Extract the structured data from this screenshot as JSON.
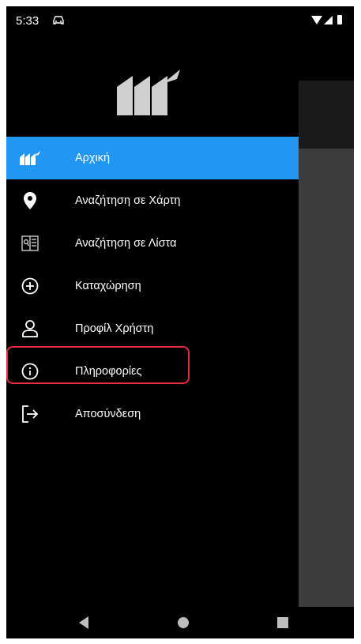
{
  "status_bar": {
    "time": "5:33"
  },
  "drawer": {
    "items": [
      {
        "label": "Αρχική",
        "icon": "home-logo-icon",
        "active": true
      },
      {
        "label": "Αναζήτηση σε Χάρτη",
        "icon": "map-pin-icon",
        "active": false
      },
      {
        "label": "Αναζήτηση σε Λίστα",
        "icon": "list-search-icon",
        "active": false
      },
      {
        "label": "Καταχώρηση",
        "icon": "add-circle-icon",
        "active": false
      },
      {
        "label": "Προφίλ Χρήστη",
        "icon": "user-icon",
        "active": false
      },
      {
        "label": "Πληροφορίες",
        "icon": "info-icon",
        "active": false
      },
      {
        "label": "Αποσύνδεση",
        "icon": "logout-icon",
        "active": false
      }
    ]
  },
  "colors": {
    "accent": "#2196f3",
    "highlight": "#e3293c"
  }
}
